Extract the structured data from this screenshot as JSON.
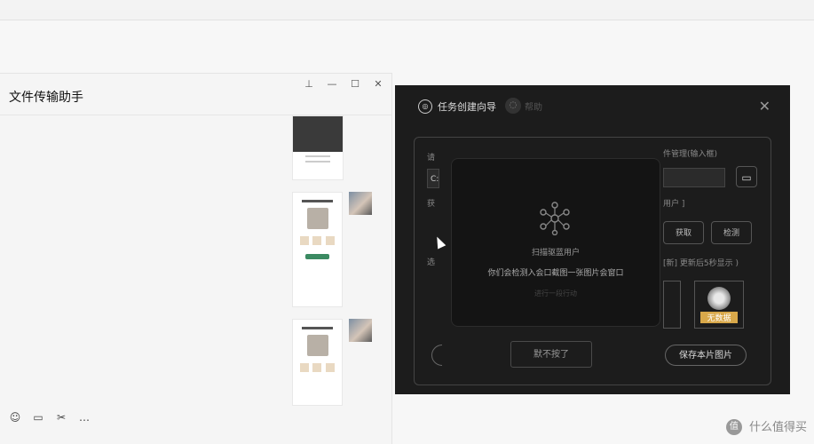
{
  "chat": {
    "title": "文件传输助手",
    "controls": {
      "pin": "⊥",
      "minimize": "—",
      "maximize": "☐",
      "close": "✕"
    },
    "toolbar": {
      "emoji": "☺",
      "folder": "▭",
      "scissors": "✂",
      "chat": "…"
    }
  },
  "dialog": {
    "tab_wizard": "任务创建向导",
    "tab_help": "帮助",
    "close": "✕",
    "path_label": "请",
    "path_value": "C:",
    "dir_hint": "件管理(输入框)",
    "folder_icon": "▭",
    "user_hint": "用户 ]",
    "row_label_1": "获",
    "get_button": "获取",
    "check_button": "检测",
    "row_label_2": "选",
    "refresh_hint": "[新] 更新后5秒显示 )",
    "no_data_label": "无数据",
    "save_button": "保存本片图片"
  },
  "modal": {
    "title": "扫描驱蓝用户",
    "description": "你们会检测入会口截图一张图片会窗口",
    "link": "进行一段行动",
    "button": "默不按了"
  },
  "watermark": {
    "logo": "值",
    "text": "什么值得买"
  }
}
